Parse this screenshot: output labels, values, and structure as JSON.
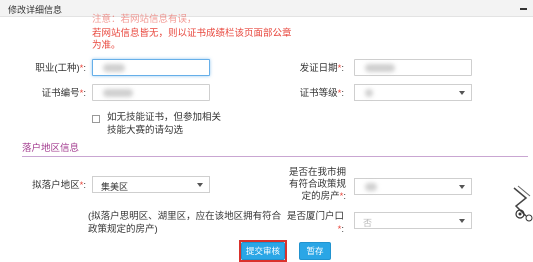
{
  "panel": {
    "title": "修改详细信息",
    "collapse_icon": "minus-icon"
  },
  "notice": {
    "faded_line": "注意：若网站信息有误，",
    "line1": "若网站信息皆无，则以证书成绩栏该页面部公章",
    "line2": "为准。"
  },
  "form": {
    "occupation": {
      "label": "职业(工种)",
      "required_mark": "*",
      "value": ""
    },
    "issue_date": {
      "label": "发证日期",
      "required_mark": "*",
      "value": ""
    },
    "cert_number": {
      "label": "证书编号",
      "required_mark": "*",
      "value": ""
    },
    "cert_level": {
      "label": "证书等级",
      "required_mark": "*",
      "value": ""
    },
    "no_cert_checkbox": {
      "label": "如无技能证书，但参加相关技能大赛的请勾选",
      "checked": false
    }
  },
  "settlement": {
    "section_title": "落户地区信息",
    "district": {
      "label": "拟落户地区",
      "required_mark": "*",
      "value": "集美区"
    },
    "has_property": {
      "label": "是否在我市拥有符合政策规定的房产",
      "required_mark": "*",
      "value": ""
    },
    "xiamen_hukou": {
      "label": "是否厦门户口",
      "required_mark": "*",
      "value": "否"
    },
    "hint": "(拟落户思明区、湖里区，应在该地区拥有符合政策规定的房产)"
  },
  "buttons": {
    "submit": "提交审核",
    "save": "暂存"
  },
  "colors": {
    "accent": "#2aa6e6",
    "required": "#e8463c",
    "section": "#a23a8e",
    "highlight": "#d9322c"
  }
}
